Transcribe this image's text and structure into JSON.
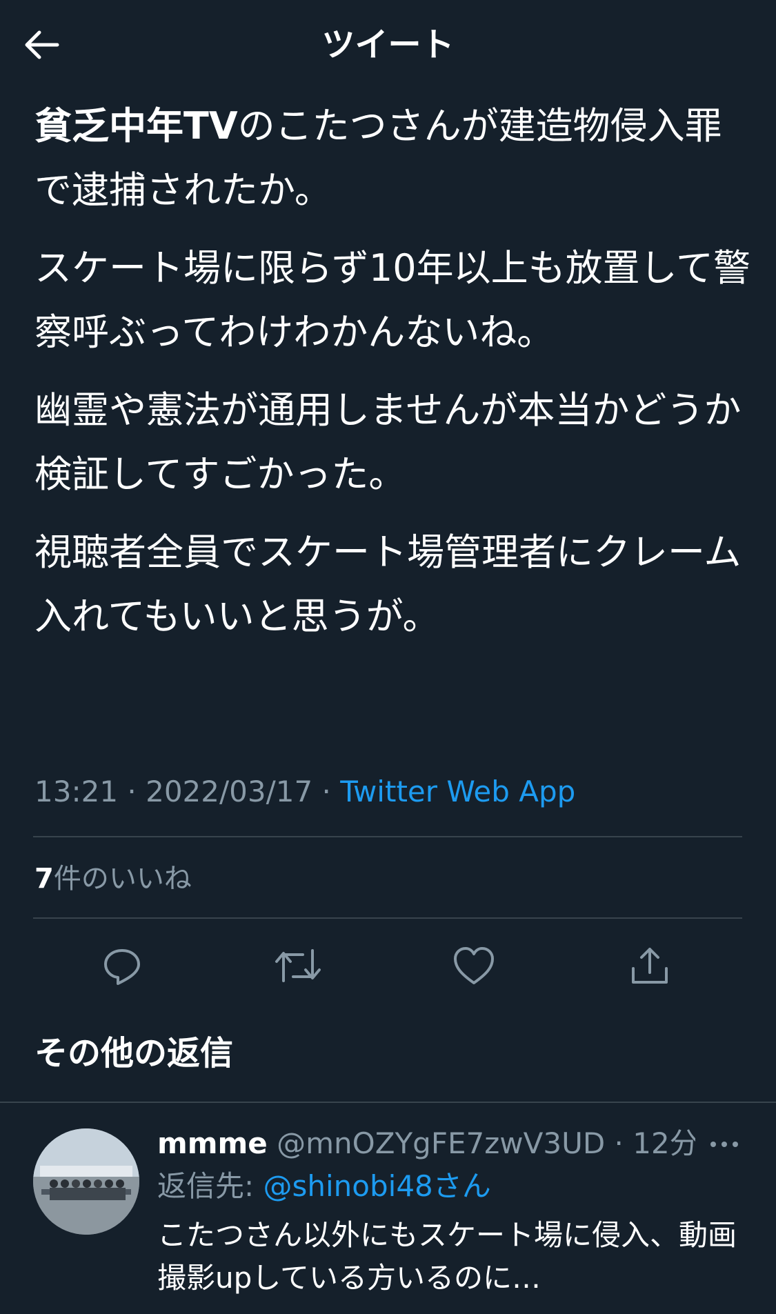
{
  "header": {
    "back_icon": "arrow-left-icon",
    "title": "ツイート"
  },
  "tweet": {
    "paragraphs": [
      {
        "strong": "貧乏中年TV",
        "text": "のこたつさんが建造物侵入罪で逮捕されたか。"
      },
      {
        "strong": "",
        "text": "スケート場に限らず10年以上も放置して警察呼ぶってわけわかんないね。"
      },
      {
        "strong": "",
        "text": "幽霊や憲法が通用しませんが本当かどうか検証してすごかった。"
      },
      {
        "strong": "",
        "text": "視聴者全員でスケート場管理者にクレーム入れてもいいと思うが。"
      }
    ],
    "time": "13:21",
    "separator": " · ",
    "date": "2022/03/17",
    "source": "Twitter Web App",
    "likes_count": "7",
    "likes_label": "件のいいね"
  },
  "actions": [
    {
      "name": "reply-icon"
    },
    {
      "name": "retweet-icon"
    },
    {
      "name": "like-icon"
    },
    {
      "name": "share-icon"
    }
  ],
  "more_replies": {
    "title": "その他の返信"
  },
  "reply": {
    "name": "mmme",
    "handle": "@mnOZYgFE7zwV3UD",
    "dot": " · ",
    "time": "12分",
    "reply_to_label": "返信先: ",
    "reply_to_mention": "@shinobi48さん",
    "text": "こたつさん以外にもスケート場に侵入、動画撮影upしている方いるのに…"
  },
  "colors": {
    "background": "#15202b",
    "text": "#ffffff",
    "secondary": "#8899a6",
    "accent": "#1d9bf0",
    "divider": "#38444d"
  }
}
